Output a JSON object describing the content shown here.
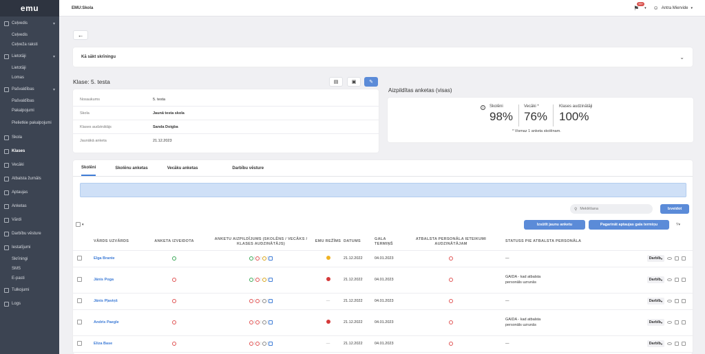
{
  "app": {
    "logo": "emu",
    "title": "EMU:Skola"
  },
  "user": {
    "notifications": "99+",
    "name": "Antra Miervide"
  },
  "sidebar": {
    "sections": [
      {
        "label": "Ceļvedis",
        "sub": [
          "Ceļvedis",
          "Ceļveža raksti"
        ]
      },
      {
        "label": "Lietotāji",
        "sub": [
          "Lietotāji",
          "Lomas"
        ]
      },
      {
        "label": "Pašvaldības",
        "sub": [
          "Pašvaldības",
          "Pakalpojumi",
          "Pielietkie pakalpojumi"
        ]
      },
      {
        "label": "Skola"
      },
      {
        "label": "Klases"
      },
      {
        "label": "Vecāki"
      },
      {
        "label": "Atbalsta žurnāls"
      },
      {
        "label": "Aptaujas"
      },
      {
        "label": "Anketas"
      },
      {
        "label": "Vārdi"
      },
      {
        "label": "Darbību vēsture"
      },
      {
        "label": "Iestatījumi",
        "sub": [
          "Skrīningi",
          "SMS",
          "E-pasti"
        ]
      },
      {
        "label": "Tulkojumi"
      },
      {
        "label": "Logs"
      }
    ]
  },
  "guide": {
    "label": "Kā sākt skrīningu"
  },
  "class": {
    "title": "Klase: 5. testa",
    "rows": [
      {
        "key": "Nosaukums",
        "value": "5. testa"
      },
      {
        "key": "Skola",
        "value": "Jaunā testa skola"
      },
      {
        "key": "Klases audzinātājs",
        "value": "Sanda Doigba"
      },
      {
        "key": "Jaunākā anketa",
        "value": "21.12.2023"
      }
    ]
  },
  "stats": {
    "title": "Aizpildītas anketas (visas)",
    "items": [
      {
        "label": "Skolēni",
        "value": "98%"
      },
      {
        "label": "Vecāki *",
        "value": "76%"
      },
      {
        "label": "Klases audzinātāji",
        "value": "100%"
      }
    ],
    "footnote": "* Vismaz 1 anketa skolēnam."
  },
  "tabs": [
    "Skolēni",
    "Skolēnu anketas",
    "Vecāku anketas",
    "Darbību vēsture"
  ],
  "search": {
    "placeholder": "Meklēšana",
    "button": "Izveidot"
  },
  "actions": {
    "send": "Izsūtīt jaunu anketu",
    "extend": "Pagarināt aptaujas gala termiņu"
  },
  "table": {
    "headers": [
      "Vārds uzvārds",
      "Anketa izveidota",
      "Anketu aizpildījums (skolēns / vecāks / klases audzinātājs)",
      "EMU režīms",
      "Datums",
      "Gala termiņš",
      "Atbalsta personāla ieteikumi audzinātājam",
      "Statuss pie atbalsta personāla"
    ],
    "action_label": "Darbīb",
    "rows": [
      {
        "name": "Elga Brante",
        "created": "green",
        "fill": [
          "green",
          "red",
          "yellow",
          "edit"
        ],
        "mode": "yellow",
        "date": "21.12.2022",
        "due": "04.01.2023",
        "support": "red",
        "status": "—"
      },
      {
        "name": "Jānis Poga",
        "created": "red",
        "fill": [
          "green",
          "red",
          "yellow",
          "edit"
        ],
        "mode": "red",
        "date": "21.12.2022",
        "due": "04.01.2023",
        "support": "red",
        "status": "GAIDA - kad atbalsta personāls uzrunās"
      },
      {
        "name": "Jānis Pļaviņš",
        "created": "red",
        "fill": [
          "red",
          "red",
          "gray",
          "edit"
        ],
        "mode": "none",
        "date": "21.12.2022",
        "due": "04.01.2023",
        "support": "red",
        "status": "—"
      },
      {
        "name": "Andris Paegle",
        "created": "red",
        "fill": [
          "red",
          "red",
          "gray",
          "edit"
        ],
        "mode": "red",
        "date": "21.12.2022",
        "due": "04.01.2023",
        "support": "red",
        "status": "GAIDA - kad atbalsta personāls uzrunās"
      },
      {
        "name": "Eliza Base",
        "created": "red",
        "fill": [
          "red",
          "red",
          "gray",
          "edit"
        ],
        "mode": "none",
        "date": "21.12.2022",
        "due": "04.01.2023",
        "support": "red",
        "status": "—"
      }
    ]
  }
}
